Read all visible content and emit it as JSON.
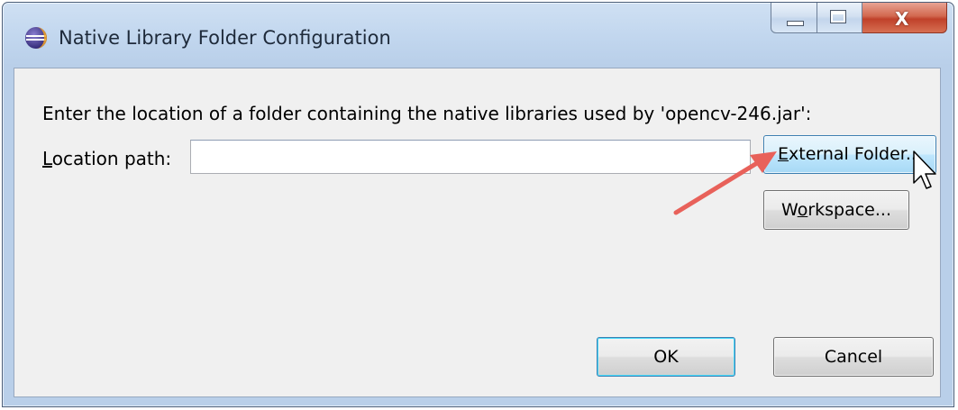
{
  "window": {
    "title": "Native Library Folder Configuration",
    "icon": "eclipse-icon",
    "caption_buttons": [
      "minimize-icon",
      "maximize-icon",
      "close-icon"
    ]
  },
  "dialog": {
    "prompt": "Enter the location of a folder containing the native libraries used by 'opencv-246.jar':",
    "location_label_mnemonic": "L",
    "location_label_rest": "ocation path:",
    "location_value": "",
    "external_folder": {
      "mnemonic": "E",
      "rest": "xternal Folder..."
    },
    "workspace": {
      "pre": "W",
      "mnemonic": "o",
      "rest": "rkspace..."
    },
    "ok_label": "OK",
    "cancel_label": "Cancel"
  },
  "annotation": {
    "arrow_color": "#e8615a",
    "cursor": "pointer-cursor-icon"
  },
  "colors": {
    "title_bar": "#c1d6ee",
    "close_button": "#c0412a",
    "client_bg": "#f0f0f0",
    "focus_border": "#3c7fb1"
  }
}
